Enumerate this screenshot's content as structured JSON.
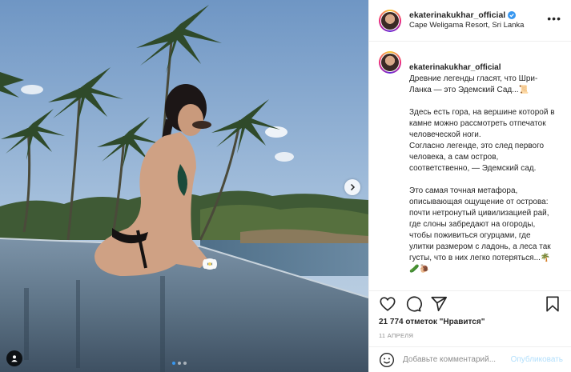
{
  "post": {
    "author": "ekaterinakukhar_official",
    "location": "Cape Weligama Resort, Sri Lanka",
    "more_label": "•••",
    "photo_alt": "",
    "carousel": {
      "total": 3,
      "active": 0
    }
  },
  "caption": {
    "username": "ekaterinakukhar_official",
    "first": "Древние легенды гласят, что Шри-Ланка — это Эдемский Сад...📜",
    "p2": "Здесь есть гора, на вершине которой в камне можно рассмотреть отпечаток человеческой ноги.\nСогласно легенде, это след первого человека, а сам остров, соответственно, — Эдемский сад.",
    "p3": "Это самая точная метафора, описывающая ощущение от острова: почти нетронутый цивилизацией рай, где слоны забредают на огороды, чтобы поживиться огурцами, где улитки размером с ладонь, а леса так густы, что в них легко потеряться...🌴🥒🐌"
  },
  "stats": {
    "likes": "21 774 отметок \"Нравится\"",
    "date": "11 АПРЕЛЯ"
  },
  "comment": {
    "placeholder": "Добавьте комментарий...",
    "publish_label": "Опубликовать",
    "emoji_icon": "smiley-icon"
  },
  "icons": [
    "heart-icon",
    "comment-icon",
    "share-icon",
    "bookmark-icon",
    "verified-icon",
    "chevron-right-icon",
    "user-tag-icon"
  ],
  "colors": {
    "accent": "#3897f0",
    "publish_disabled": "#b2dffc",
    "muted": "#8e8e8e",
    "border": "#efefef"
  }
}
